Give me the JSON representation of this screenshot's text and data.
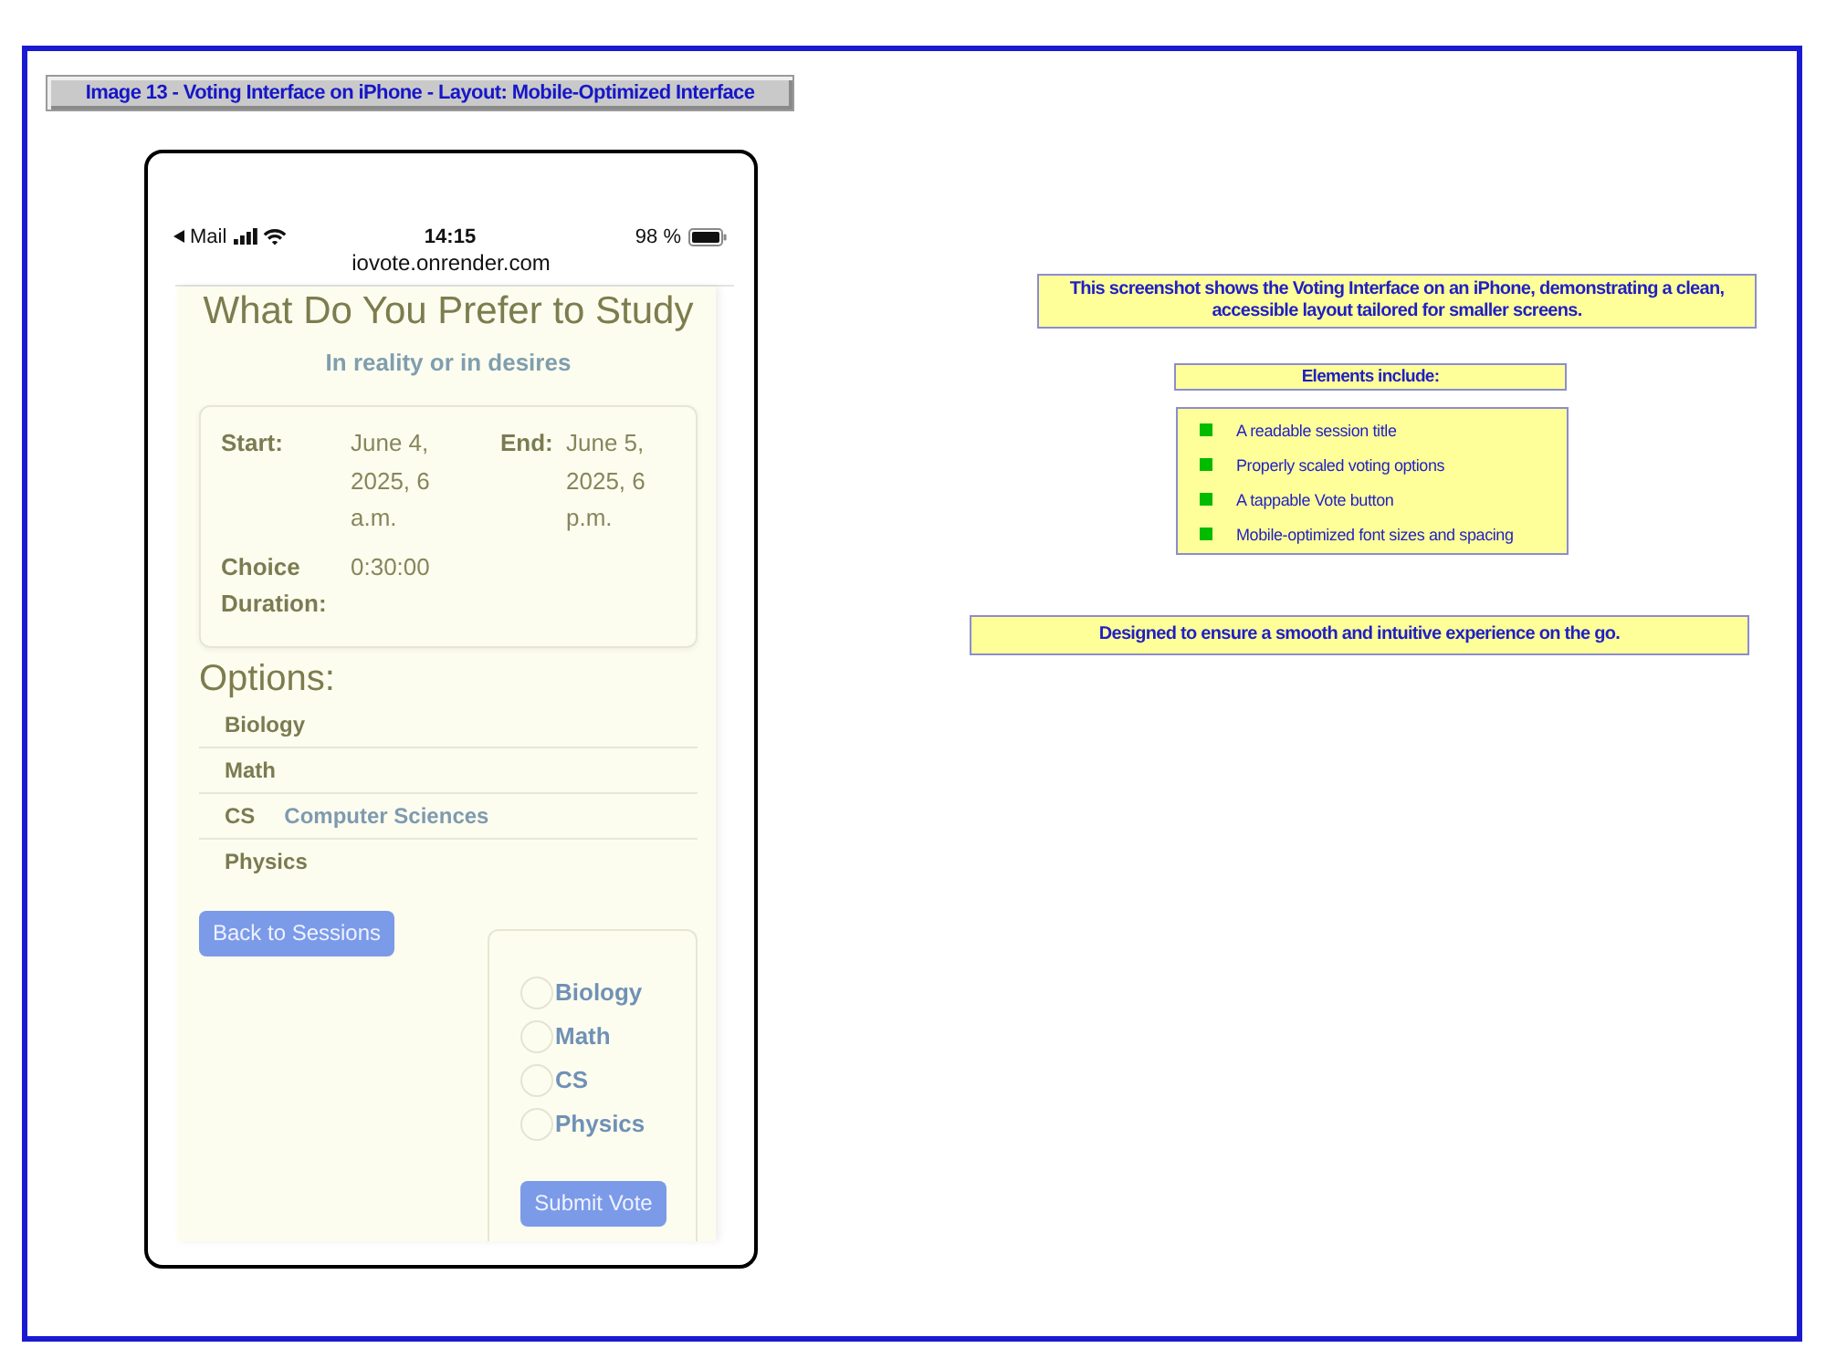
{
  "caption": "Image 13 - Voting Interface on iPhone - Layout: Mobile-Optimized Interface",
  "phone": {
    "status_bar": {
      "back_app": "Mail",
      "time": "14:15",
      "battery": "98 %"
    },
    "url": "iovote.onrender.com",
    "session": {
      "title": "What Do You Prefer to Study",
      "subtitle": "In reality or in desires",
      "details": [
        {
          "label": "Start:",
          "value": "June 4, 2025, 6 a.m."
        },
        {
          "label": "End:",
          "value": "June 5, 2025, 6 p.m."
        },
        {
          "label": "Choice Duration:",
          "value": "0:30:00"
        }
      ]
    },
    "options_heading": "Options:",
    "options": [
      {
        "name": "Biology"
      },
      {
        "name": "Math"
      },
      {
        "name": "CS",
        "description": "Computer Sciences"
      },
      {
        "name": "Physics"
      }
    ],
    "back_button": "Back to Sessions",
    "vote_form": {
      "choices": [
        {
          "label": "Biology",
          "selected": false
        },
        {
          "label": "Math",
          "selected": false
        },
        {
          "label": "CS",
          "selected": false
        },
        {
          "label": "Physics",
          "selected": false
        }
      ],
      "submit": "Submit Vote"
    }
  },
  "notes": {
    "summary": "This screenshot shows the Voting Interface on an iPhone, demonstrating a clean, accessible layout tailored for smaller screens.",
    "elements_heading": "Elements include:",
    "elements": [
      "A readable session title",
      "Properly scaled voting options",
      "A tappable Vote button",
      "Mobile-optimized font sizes and spacing"
    ],
    "closing": "Designed to ensure a smooth and intuitive experience on the go."
  }
}
